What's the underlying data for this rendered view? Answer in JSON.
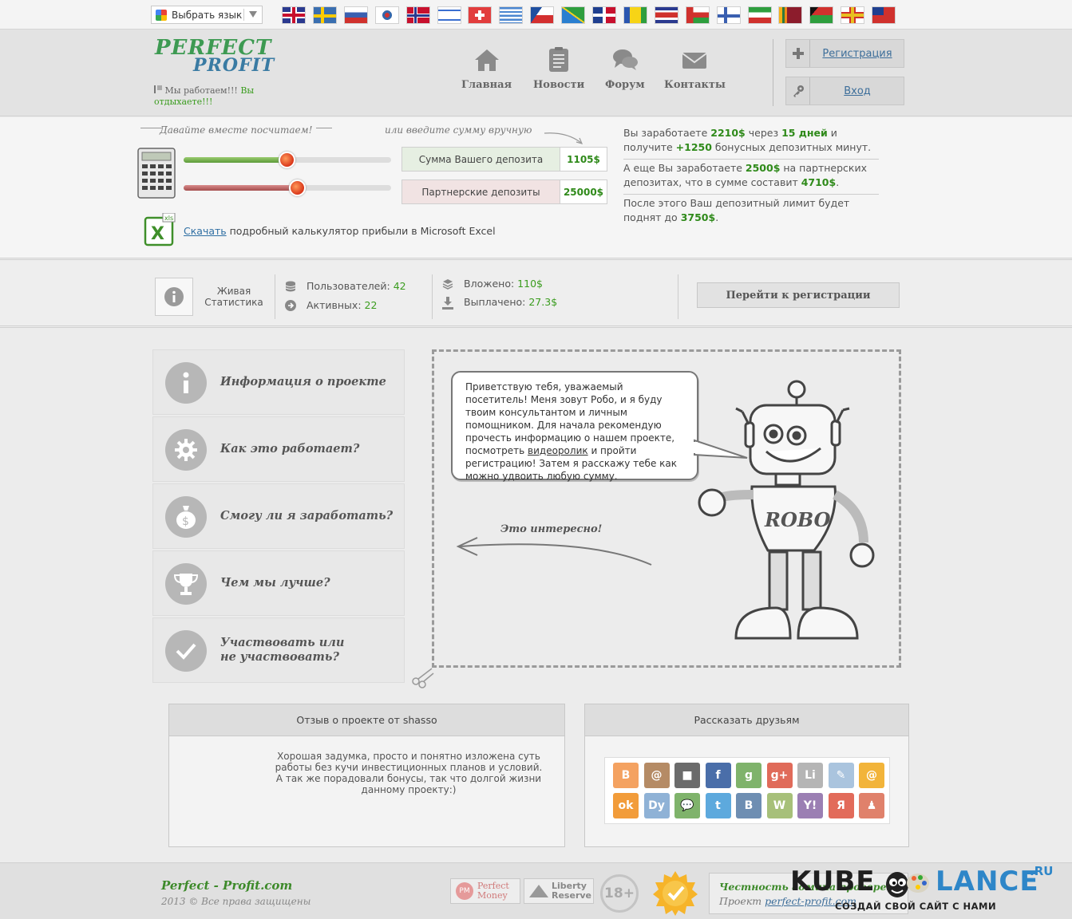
{
  "translate": {
    "label": "Выбрать язык"
  },
  "flags": [
    "uk",
    "sweden",
    "russia",
    "south-korea",
    "norway",
    "israel",
    "switzerland",
    "greece",
    "czech",
    "solomon-islands",
    "dominican-republic",
    "saint-vincent",
    "costa-rica",
    "oman",
    "finland",
    "iran",
    "sri-lanka",
    "vanuatu",
    "guernsey",
    "taiwan"
  ],
  "header": {
    "logo_line1": "PERFECT",
    "logo_line2": "PROFIT",
    "slogan_part1": "Мы работаем!!! ",
    "slogan_part2": "Вы отдыхаете!!!",
    "nav": [
      {
        "label": "Главная",
        "icon": "home-icon"
      },
      {
        "label": "Новости",
        "icon": "news-icon"
      },
      {
        "label": "Форум",
        "icon": "forum-icon"
      },
      {
        "label": "Контакты",
        "icon": "mail-icon"
      }
    ],
    "register": "Регистрация",
    "login": "Вход"
  },
  "calculator": {
    "hint_left": "Давайте вместе посчитаем!",
    "hint_right": "или введите сумму вручную",
    "deposit_label": "Сумма Вашего депозита",
    "deposit_value": "1105$",
    "deposit_fraction": 0.45,
    "partner_label": "Партнерские депозиты",
    "partner_value": "25000$",
    "partner_fraction": 0.5,
    "download_link": "Скачать",
    "download_text": " подробный калькулятор прибыли в Microsoft Excel",
    "summary": {
      "l1_a": "Вы заработаете ",
      "l1_v1": "2210$",
      "l1_b": " через ",
      "l1_v2": "15 дней",
      "l1_c": " и получите ",
      "l1_v3": "+1250",
      "l1_d": " бонусных депозитных минут.",
      "l2_a": "А еще Вы заработаете ",
      "l2_v1": "2500$",
      "l2_b": " на партнерских депозитах, что в сумме составит ",
      "l2_v2": "4710$",
      "l2_c": ".",
      "l3_a": "После этого Ваш депозитный лимит будет поднят до ",
      "l3_v1": "3750$",
      "l3_b": "."
    }
  },
  "stats": {
    "title_l1": "Живая",
    "title_l2": "Статистика",
    "users_label": "Пользователей: ",
    "users_value": "42",
    "active_label": "Активных: ",
    "active_value": "22",
    "invested_label": "Вложено: ",
    "invested_value": "110$",
    "paid_label": "Выплачено: ",
    "paid_value": "27.3$",
    "cta": "Перейти к регистрации"
  },
  "menu": [
    {
      "label": "Информация о проекте",
      "icon": "info-icon"
    },
    {
      "label": "Как это работает?",
      "icon": "gear-icon"
    },
    {
      "label": "Смогу ли я заработать?",
      "icon": "money-bag-icon"
    },
    {
      "label": "Чем мы лучше?",
      "icon": "trophy-icon"
    },
    {
      "label": "Участвовать или не участвовать?",
      "icon": "check-icon"
    }
  ],
  "robo": {
    "bubble_part1": "Приветствую тебя, уважаемый посетитель! Меня зовут Робо, и я буду твоим консультантом и личным помощником. Для начала рекомендую прочесть информацию о нашем проекте, посмотреть ",
    "bubble_link": "видеоролик",
    "bubble_part2": " и пройти регистрацию! Затем я расскажу тебе как можно удвоить любую сумму.",
    "arrow_text": "Это интересно!",
    "chest_text": "ROBO"
  },
  "review": {
    "title": "Отзыв о проекте от shasso",
    "text": "Хорошая задумка, просто и понятно изложена суть работы без кучи инвестиционных планов и условий. А так же порадовали бонусы, так что долгой жизни данному проекту:)"
  },
  "share": {
    "title": "Рассказать друзьям",
    "icons": [
      {
        "name": "blogger-icon",
        "glyph": "B",
        "color": "#f4a261"
      },
      {
        "name": "mailru-icon",
        "glyph": "@",
        "color": "#b58b65"
      },
      {
        "name": "delicious-icon",
        "glyph": "■",
        "color": "#6b6b6b"
      },
      {
        "name": "facebook-icon",
        "glyph": "f",
        "color": "#4a6ea9"
      },
      {
        "name": "google-icon",
        "glyph": "g",
        "color": "#7fb36b"
      },
      {
        "name": "google-plus-icon",
        "glyph": "g+",
        "color": "#e06b5a"
      },
      {
        "name": "linkedin-icon",
        "glyph": "Li",
        "color": "#b5b5b5"
      },
      {
        "name": "livejournal-icon",
        "glyph": "✎",
        "color": "#aac4de"
      },
      {
        "name": "email-icon",
        "glyph": "@",
        "color": "#f2b43a"
      },
      {
        "name": "odnoklassniki-icon",
        "glyph": "ok",
        "color": "#f29c3a"
      },
      {
        "name": "diary-icon",
        "glyph": "Dy",
        "color": "#8fb2d6"
      },
      {
        "name": "chat-icon",
        "glyph": "💬",
        "color": "#7fb36b"
      },
      {
        "name": "twitter-icon",
        "glyph": "t",
        "color": "#5da9dd"
      },
      {
        "name": "vkontakte-icon",
        "glyph": "B",
        "color": "#6e8eb2"
      },
      {
        "name": "wordpress-icon",
        "glyph": "W",
        "color": "#a7c07a"
      },
      {
        "name": "yahoo-icon",
        "glyph": "Y!",
        "color": "#9b7fb3"
      },
      {
        "name": "yandex-icon",
        "glyph": "Я",
        "color": "#e26b5a"
      },
      {
        "name": "moikrug-icon",
        "glyph": "♟",
        "color": "#e0816b"
      }
    ]
  },
  "footer": {
    "site": "Perfect - Profit.com",
    "copyright": "2013 © Все права защищены",
    "pm_label": "Perfect Money",
    "lr_label": "Liberty Reserve",
    "age": "18+",
    "honesty_title": "Честность админа проверена!",
    "honesty_project": "Проект ",
    "honesty_link": "perfect-profit.com",
    "watermark_a": "KUBE",
    "watermark_b": "LANCE",
    "watermark_c": ".RU",
    "watermark_sub": "СОЗДАЙ СВОЙ САЙТ С НАМИ"
  }
}
